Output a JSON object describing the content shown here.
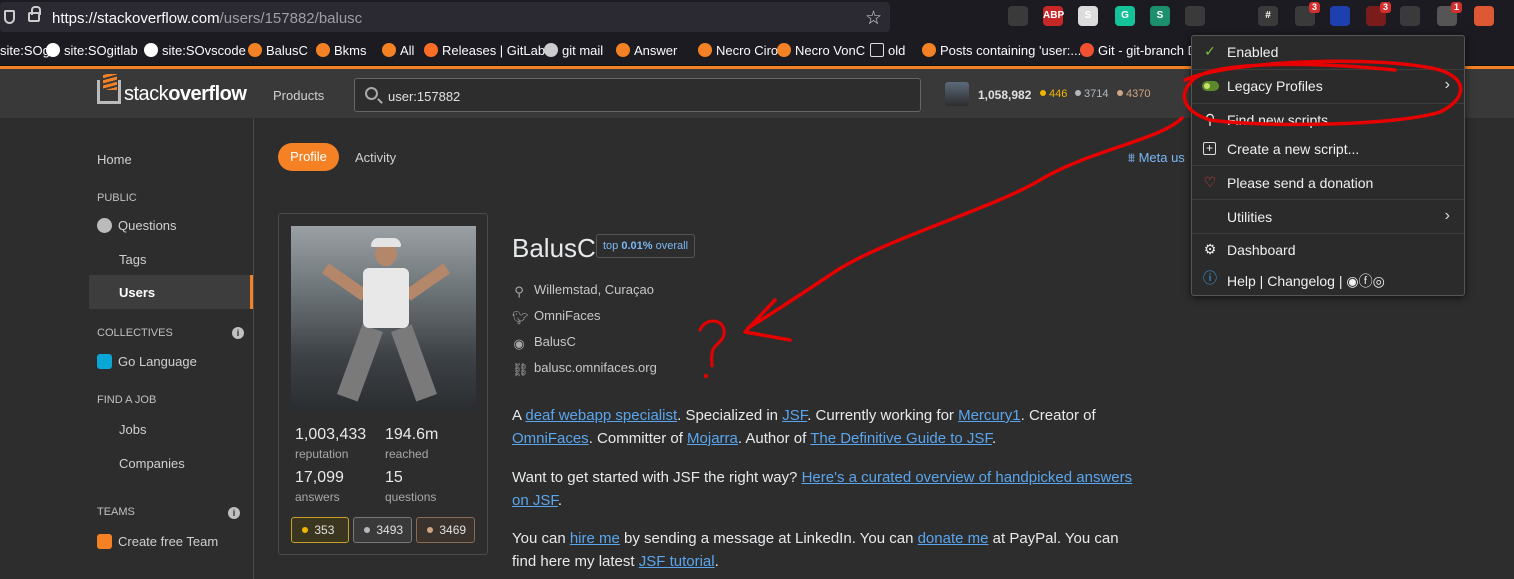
{
  "browser": {
    "url_host": "https://stackoverflow.com",
    "url_path": "/users/157882/balusc",
    "extensions": [
      {
        "name": "pocket-icon",
        "color": "#3a3a3a",
        "label": ""
      },
      {
        "name": "adblock-icon",
        "color": "#c62828",
        "label": "ABP"
      },
      {
        "name": "s-icon",
        "color": "#dcdcdc",
        "label": "S"
      },
      {
        "name": "grammarly-icon",
        "color": "#15c39a",
        "label": "G"
      },
      {
        "name": "s2-icon",
        "color": "#1d8f6a",
        "label": "S"
      },
      {
        "name": "bell-icon",
        "color": "#3a3a3a",
        "label": ""
      },
      {
        "name": "hash-icon",
        "color": "#3a3a3a",
        "label": "#"
      },
      {
        "name": "drop-icon",
        "color": "#3a3a3a",
        "label": "",
        "badge": "3"
      },
      {
        "name": "shield-icon",
        "color": "#1e40af",
        "label": ""
      },
      {
        "name": "ublock-icon",
        "color": "#7a1c1c",
        "label": "",
        "badge": "3"
      },
      {
        "name": "pin-icon",
        "color": "#3a3a3a",
        "label": ""
      },
      {
        "name": "tampermonkey-icon",
        "color": "#555555",
        "label": "",
        "badge": "1"
      },
      {
        "name": "duck-icon",
        "color": "#de5833",
        "label": ""
      }
    ]
  },
  "bookmarks": [
    {
      "label": "site:SOgit",
      "icon": "google"
    },
    {
      "label": "site:SOgitlab",
      "icon": "google"
    },
    {
      "label": "site:SOvscode",
      "icon": "google"
    },
    {
      "label": "BalusC",
      "icon": "so"
    },
    {
      "label": "Bkms",
      "icon": "so"
    },
    {
      "label": "All",
      "icon": "so"
    },
    {
      "label": "Releases | GitLab",
      "icon": "gitlab"
    },
    {
      "label": "git mail",
      "icon": "globe"
    },
    {
      "label": "Answer",
      "icon": "so"
    },
    {
      "label": "Necro Ciro",
      "icon": "so"
    },
    {
      "label": "Necro VonC",
      "icon": "so"
    },
    {
      "label": "old",
      "icon": "folder"
    },
    {
      "label": "Posts containing 'user:...",
      "icon": "so"
    },
    {
      "label": "Git - git-branch D",
      "icon": "git"
    }
  ],
  "bookmark_overflow": "reference",
  "header": {
    "logo_light": "stack",
    "logo_bold": "overflow",
    "products": "Products",
    "search_value": "user:157882",
    "reputation": "1,058,982",
    "gold": "446",
    "silver": "3714",
    "bronze": "4370"
  },
  "sidebar": {
    "home": "Home",
    "public": "PUBLIC",
    "questions": "Questions",
    "tags": "Tags",
    "users": "Users",
    "collectives": "COLLECTIVES",
    "go_language": "Go Language",
    "find_job": "FIND A JOB",
    "jobs": "Jobs",
    "companies": "Companies",
    "teams": "TEAMS",
    "create_team": "Create free Team"
  },
  "tabs": {
    "profile": "Profile",
    "activity": "Activity"
  },
  "meta_link": "Meta us",
  "profile": {
    "name": "BalusC",
    "top_prefix": "top",
    "top_value": "0.01%",
    "top_suffix": "overall",
    "location": "Willemstad, Curaçao",
    "twitter": "OmniFaces",
    "github": "BalusC",
    "website": "balusc.omnifaces.org"
  },
  "stats": {
    "reputation_value": "1,003,433",
    "reputation_label": "reputation",
    "reached_value": "194.6m",
    "reached_label": "reached",
    "answers_value": "17,099",
    "answers_label": "answers",
    "questions_value": "15",
    "questions_label": "questions",
    "gold": "353",
    "silver": "3493",
    "bronze": "3469"
  },
  "about": {
    "p1": [
      {
        "t": "A "
      },
      {
        "t": "deaf webapp specialist",
        "link": true
      },
      {
        "t": ". Specialized in "
      },
      {
        "t": "JSF",
        "link": true
      },
      {
        "t": ". Currently working for "
      },
      {
        "t": "Mercury1",
        "link": true
      },
      {
        "t": ". Creator of "
      },
      {
        "t": "OmniFaces",
        "link": true
      },
      {
        "t": ". Committer of "
      },
      {
        "t": "Mojarra",
        "link": true
      },
      {
        "t": ". Author of "
      },
      {
        "t": "The Definitive Guide to JSF",
        "link": true
      },
      {
        "t": "."
      }
    ],
    "p2": [
      {
        "t": "Want to get started with JSF the right way? "
      },
      {
        "t": "Here's a curated overview of handpicked answers on JSF",
        "link": true
      },
      {
        "t": "."
      }
    ],
    "p3": [
      {
        "t": "You can "
      },
      {
        "t": "hire me",
        "link": true
      },
      {
        "t": " by sending a message at LinkedIn. You can "
      },
      {
        "t": "donate me",
        "link": true
      },
      {
        "t": " at PayPal. You can find here my latest "
      },
      {
        "t": "JSF tutorial",
        "link": true
      },
      {
        "t": "."
      }
    ]
  },
  "menu": {
    "enabled": "Enabled",
    "legacy_profiles": "Legacy Profiles",
    "find_scripts": "Find new scripts...",
    "create_script": "Create a new script...",
    "donation": "Please send a donation",
    "utilities": "Utilities",
    "dashboard": "Dashboard",
    "help": "Help | Changelog |"
  },
  "colors": {
    "accent": "#f48225",
    "link": "#5aa6ee",
    "annotation": "#e60000"
  }
}
